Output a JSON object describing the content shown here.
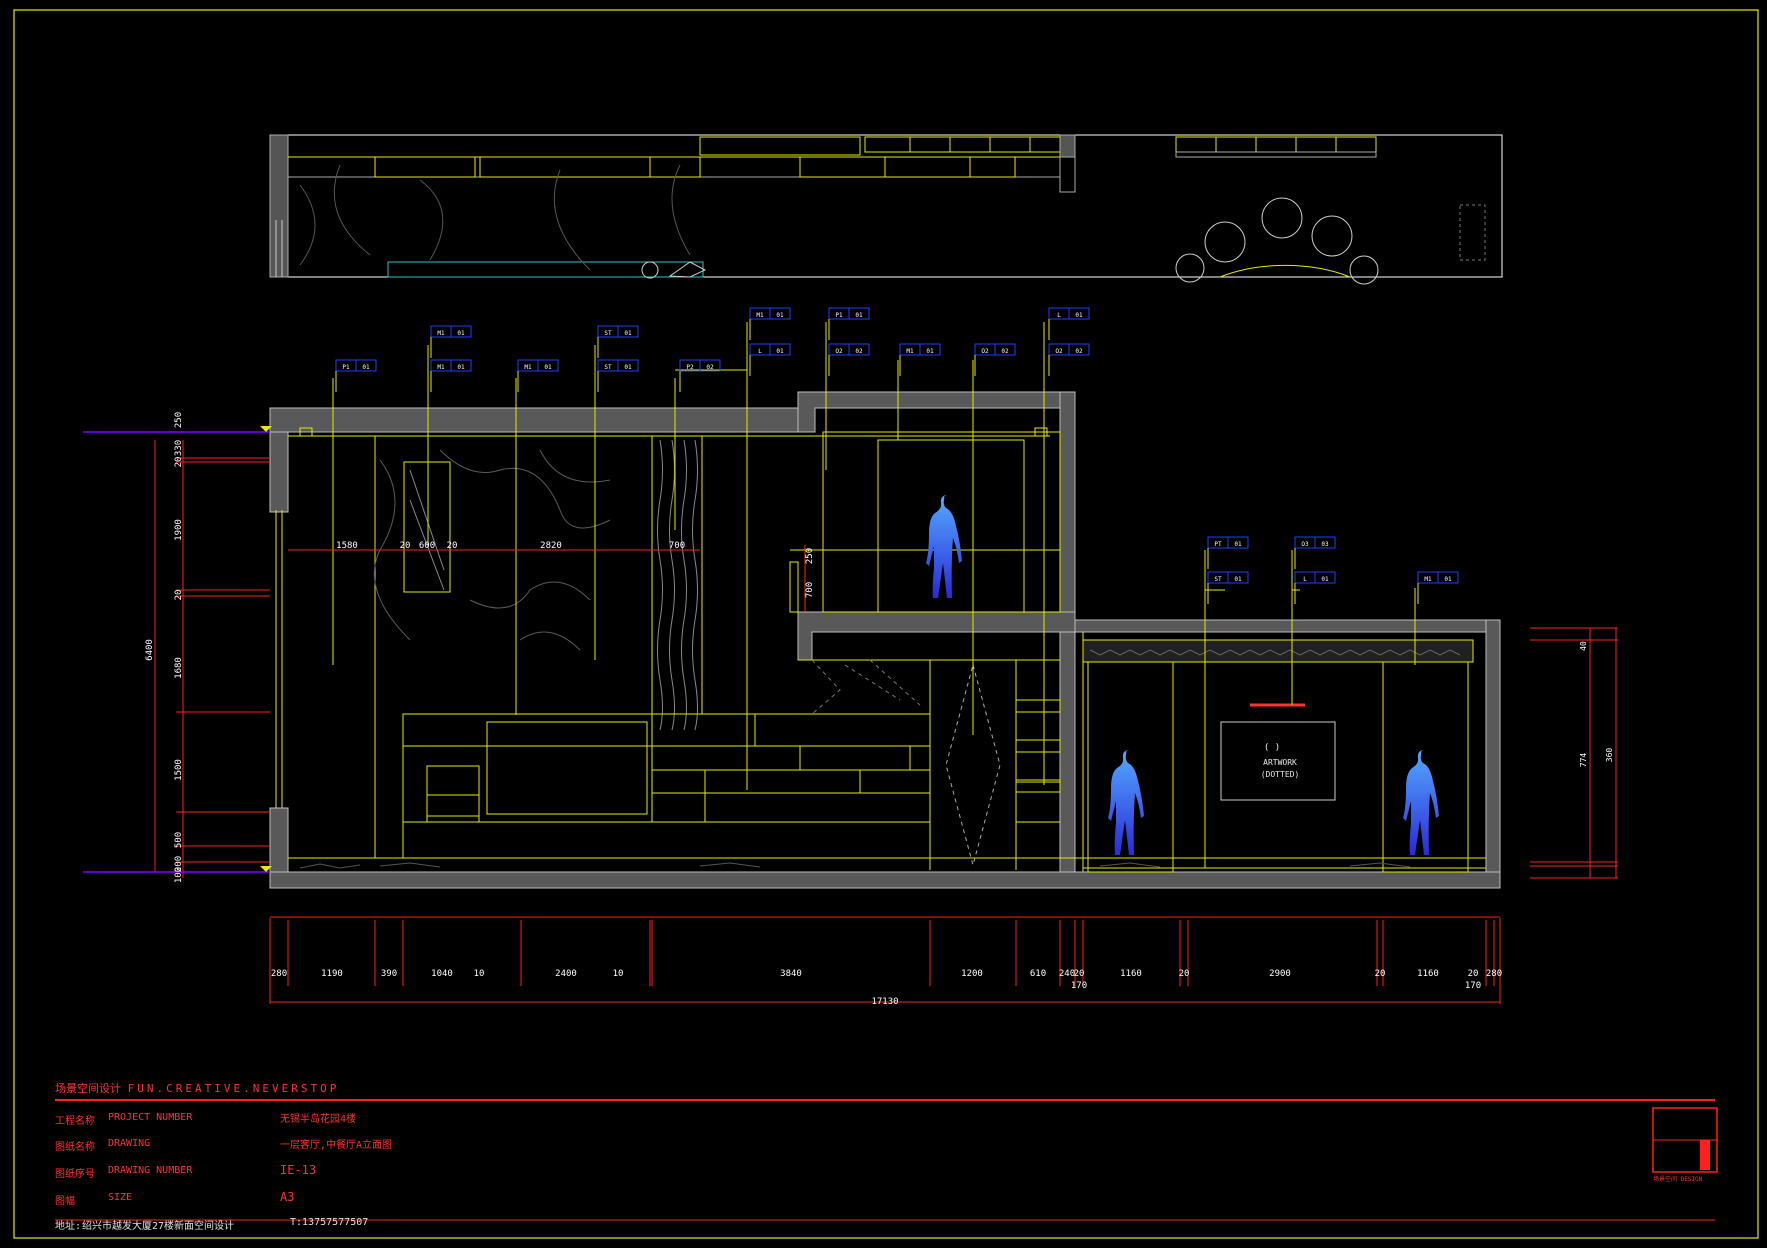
{
  "colors": {
    "background": "#000000",
    "frame": "#e8e800",
    "wall": "#a0a0a0",
    "line": "#e8e800",
    "dimension": "#ff2020",
    "dim_text": "#ffffff",
    "tag": "#1a40ff",
    "purple": "#8000ff",
    "figure_top": "#55aaff",
    "figure_bottom": "#2a2ad8"
  },
  "elevation": {
    "bottom_dimensions": [
      "280",
      "1190",
      "390",
      "1040",
      "10",
      "2400",
      "10",
      "3840",
      "1200",
      "610",
      "240",
      "20",
      "1160",
      "20",
      "2900",
      "20",
      "1160",
      "20",
      "280"
    ],
    "bottom_total": "17130",
    "bottom_sub": [
      "170",
      "170"
    ],
    "left_total": "6400",
    "left_dimensions": [
      "250",
      "330",
      "20",
      "1900",
      "20",
      "1680",
      "1500",
      "500",
      "200",
      "100"
    ],
    "right_dimensions": [
      "40",
      "774",
      "360"
    ],
    "inner_dimensions": [
      "1580",
      "20",
      "600",
      "20",
      "2820",
      "700"
    ],
    "small_dimensions": [
      "250",
      "700"
    ],
    "artwork_lines": [
      "( )",
      "ARTWORK",
      "(DOTTED)"
    ]
  },
  "tags": [
    {
      "code": "P1",
      "num": "01"
    },
    {
      "code": "M1",
      "num": "01"
    },
    {
      "code": "M1",
      "num": "01"
    },
    {
      "code": "M1",
      "num": "01"
    },
    {
      "code": "ST",
      "num": "01"
    },
    {
      "code": "ST",
      "num": "01"
    },
    {
      "code": "P2",
      "num": "02"
    },
    {
      "code": "M1",
      "num": "01"
    },
    {
      "code": "L",
      "num": "01"
    },
    {
      "code": "P1",
      "num": "01"
    },
    {
      "code": "O2",
      "num": "02"
    },
    {
      "code": "M1",
      "num": "01"
    },
    {
      "code": "O2",
      "num": "02"
    },
    {
      "code": "L",
      "num": "01"
    },
    {
      "code": "O2",
      "num": "02"
    },
    {
      "code": "PT",
      "num": "01"
    },
    {
      "code": "ST",
      "num": "01"
    },
    {
      "code": "O3",
      "num": "03"
    },
    {
      "code": "L",
      "num": "01"
    },
    {
      "code": "M1",
      "num": "01"
    }
  ],
  "title_block": {
    "company": "场景空间设计",
    "slogan": "FUN.CREATIVE.NEVERSTOP",
    "rows": [
      {
        "cn": "工程名称",
        "en": "PROJECT NUMBER",
        "value": "无锡半岛花园4楼"
      },
      {
        "cn": "图纸名称",
        "en": "DRAWING",
        "value": "一层客厅,中餐厅A立面图"
      },
      {
        "cn": "图纸序号",
        "en": "DRAWING NUMBER",
        "value": "IE-13"
      },
      {
        "cn": "图幅",
        "en": "SIZE",
        "value": "A3"
      }
    ],
    "address_label": "地址:",
    "address": "绍兴市越发大厦27楼新面空间设计",
    "phone": "T:13757577507",
    "logo_caption": "场景空间 DESIGN"
  }
}
